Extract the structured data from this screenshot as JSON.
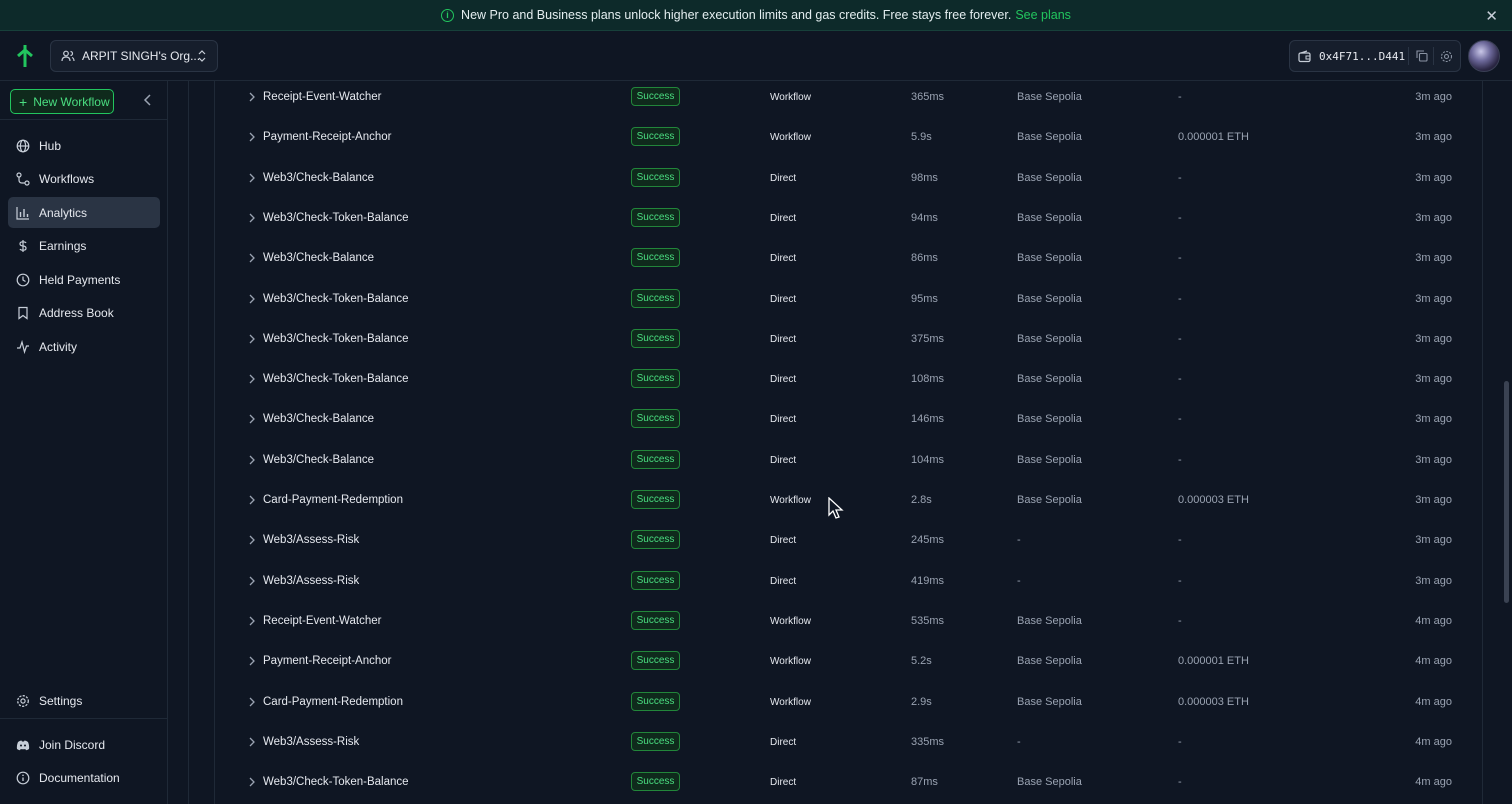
{
  "banner": {
    "message": "New Pro and Business plans unlock higher execution limits and gas credits. Free stays free forever.",
    "link": "See plans",
    "close": "✕"
  },
  "header": {
    "org_name": "ARPIT SINGH's Org...",
    "wallet_address": "0x4F71...D441"
  },
  "sidebar": {
    "new_workflow": "New Workflow",
    "items": [
      {
        "label": "Hub",
        "icon": "globe-icon"
      },
      {
        "label": "Workflows",
        "icon": "workflow-icon"
      },
      {
        "label": "Analytics",
        "icon": "bar-chart-icon"
      },
      {
        "label": "Earnings",
        "icon": "dollar-icon"
      },
      {
        "label": "Held Payments",
        "icon": "clock-icon"
      },
      {
        "label": "Address Book",
        "icon": "bookmark-icon"
      },
      {
        "label": "Activity",
        "icon": "activity-icon"
      }
    ],
    "settings": "Settings",
    "join_discord": "Join Discord",
    "documentation": "Documentation"
  },
  "rows": [
    {
      "name": "Receipt-Event-Watcher",
      "status": "Success",
      "type": "Workflow",
      "duration": "365ms",
      "network": "Base Sepolia",
      "cost": "-",
      "time": "3m ago"
    },
    {
      "name": "Payment-Receipt-Anchor",
      "status": "Success",
      "type": "Workflow",
      "duration": "5.9s",
      "network": "Base Sepolia",
      "cost": "0.000001 ETH",
      "time": "3m ago"
    },
    {
      "name": "Web3/Check-Balance",
      "status": "Success",
      "type": "Direct",
      "duration": "98ms",
      "network": "Base Sepolia",
      "cost": "-",
      "time": "3m ago"
    },
    {
      "name": "Web3/Check-Token-Balance",
      "status": "Success",
      "type": "Direct",
      "duration": "94ms",
      "network": "Base Sepolia",
      "cost": "-",
      "time": "3m ago"
    },
    {
      "name": "Web3/Check-Balance",
      "status": "Success",
      "type": "Direct",
      "duration": "86ms",
      "network": "Base Sepolia",
      "cost": "-",
      "time": "3m ago"
    },
    {
      "name": "Web3/Check-Token-Balance",
      "status": "Success",
      "type": "Direct",
      "duration": "95ms",
      "network": "Base Sepolia",
      "cost": "-",
      "time": "3m ago"
    },
    {
      "name": "Web3/Check-Token-Balance",
      "status": "Success",
      "type": "Direct",
      "duration": "375ms",
      "network": "Base Sepolia",
      "cost": "-",
      "time": "3m ago"
    },
    {
      "name": "Web3/Check-Token-Balance",
      "status": "Success",
      "type": "Direct",
      "duration": "108ms",
      "network": "Base Sepolia",
      "cost": "-",
      "time": "3m ago"
    },
    {
      "name": "Web3/Check-Balance",
      "status": "Success",
      "type": "Direct",
      "duration": "146ms",
      "network": "Base Sepolia",
      "cost": "-",
      "time": "3m ago"
    },
    {
      "name": "Web3/Check-Balance",
      "status": "Success",
      "type": "Direct",
      "duration": "104ms",
      "network": "Base Sepolia",
      "cost": "-",
      "time": "3m ago"
    },
    {
      "name": "Card-Payment-Redemption",
      "status": "Success",
      "type": "Workflow",
      "duration": "2.8s",
      "network": "Base Sepolia",
      "cost": "0.000003 ETH",
      "time": "3m ago"
    },
    {
      "name": "Web3/Assess-Risk",
      "status": "Success",
      "type": "Direct",
      "duration": "245ms",
      "network": "-",
      "cost": "-",
      "time": "3m ago"
    },
    {
      "name": "Web3/Assess-Risk",
      "status": "Success",
      "type": "Direct",
      "duration": "419ms",
      "network": "-",
      "cost": "-",
      "time": "3m ago"
    },
    {
      "name": "Receipt-Event-Watcher",
      "status": "Success",
      "type": "Workflow",
      "duration": "535ms",
      "network": "Base Sepolia",
      "cost": "-",
      "time": "4m ago"
    },
    {
      "name": "Payment-Receipt-Anchor",
      "status": "Success",
      "type": "Workflow",
      "duration": "5.2s",
      "network": "Base Sepolia",
      "cost": "0.000001 ETH",
      "time": "4m ago"
    },
    {
      "name": "Card-Payment-Redemption",
      "status": "Success",
      "type": "Workflow",
      "duration": "2.9s",
      "network": "Base Sepolia",
      "cost": "0.000003 ETH",
      "time": "4m ago"
    },
    {
      "name": "Web3/Assess-Risk",
      "status": "Success",
      "type": "Direct",
      "duration": "335ms",
      "network": "-",
      "cost": "-",
      "time": "4m ago"
    },
    {
      "name": "Web3/Check-Token-Balance",
      "status": "Success",
      "type": "Direct",
      "duration": "87ms",
      "network": "Base Sepolia",
      "cost": "-",
      "time": "4m ago"
    }
  ]
}
